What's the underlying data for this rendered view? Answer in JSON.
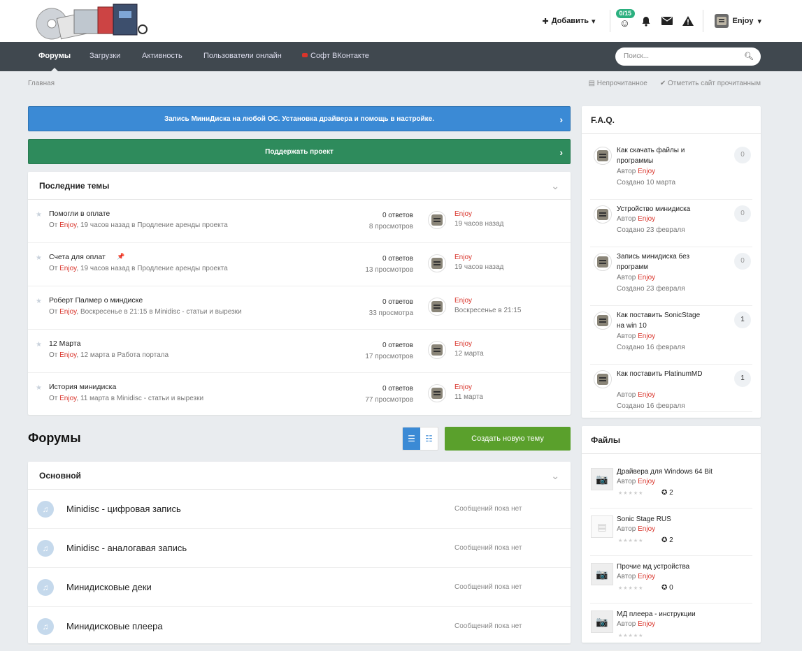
{
  "header": {
    "add_label": "Добавить",
    "badge": "0/15",
    "user": "Enjoy"
  },
  "nav": {
    "items": [
      "Форумы",
      "Загрузки",
      "Активность",
      "Пользователи онлайн",
      "Софт ВКонтакте"
    ],
    "search_placeholder": "Поиск..."
  },
  "breadcrumb": "Главная",
  "mark_links": [
    "Непрочитанное",
    "Отметить сайт прочитанным"
  ],
  "banners": [
    "Запись МиниДиска на любой ОС. Установка драйвера и помощь в настройке.",
    "Поддержать проект"
  ],
  "recent": {
    "title": "Последние темы",
    "topics": [
      {
        "title": "Помогли в оплате",
        "prefix": "От",
        "author": "Enjoy",
        "meta": ", 19 часов назад в Продление аренды проекта",
        "answers": "0 ответов",
        "views": "8 просмотров",
        "last_user": "Enjoy",
        "last_time": "19 часов назад",
        "pinned": false
      },
      {
        "title": "Счета для оплат",
        "prefix": "От",
        "author": "Enjoy",
        "meta": ", 19 часов назад в Продление аренды проекта",
        "answers": "0 ответов",
        "views": "13 просмотров",
        "last_user": "Enjoy",
        "last_time": "19 часов назад",
        "pinned": true
      },
      {
        "title": "Роберт Палмер о миндиске",
        "prefix": "От",
        "author": "Enjoy",
        "meta": ", Воскресенье в 21:15 в Minidisc - статьи и вырезки",
        "answers": "0 ответов",
        "views": "33 просмотра",
        "last_user": "Enjoy",
        "last_time": "Воскресенье в 21:15",
        "pinned": false
      },
      {
        "title": "12 Марта",
        "prefix": "От",
        "author": "Enjoy",
        "meta": ", 12 марта в Работа портала",
        "answers": "0 ответов",
        "views": "17 просмотров",
        "last_user": "Enjoy",
        "last_time": "12 марта",
        "pinned": false
      },
      {
        "title": "История минидиска",
        "prefix": "От",
        "author": "Enjoy",
        "meta": ", 11 марта в Minidisc - статьи и вырезки",
        "answers": "0 ответов",
        "views": "77 просмотров",
        "last_user": "Enjoy",
        "last_time": "11 марта",
        "pinned": false
      }
    ]
  },
  "forums": {
    "heading": "Форумы",
    "new_topic": "Создать новую тему",
    "category": "Основной",
    "rows": [
      {
        "name": "Minidisc - цифровая запись",
        "last": "Сообщений пока нет"
      },
      {
        "name": "Minidisc - аналогавая запись",
        "last": "Сообщений пока нет"
      },
      {
        "name": "Минидисковые деки",
        "last": "Сообщений пока нет"
      },
      {
        "name": "Минидисковые плеера",
        "last": "Сообщений пока нет"
      }
    ]
  },
  "faq": {
    "title": "F.A.Q.",
    "items": [
      {
        "title": "Как скачать файлы и программы",
        "by": "Автор",
        "author": "Enjoy",
        "created": "Создано 10 марта",
        "count": "0"
      },
      {
        "title": "Устройство минидиска",
        "by": "Автор",
        "author": "Enjoy",
        "created": "Создано 23 февраля",
        "count": "0"
      },
      {
        "title": "Запись минидиска без программ",
        "by": "Автор",
        "author": "Enjoy",
        "created": "Создано 23 февраля",
        "count": "0"
      },
      {
        "title": "Как поставить SonicStage на win 10",
        "by": "Автор",
        "author": "Enjoy",
        "created": "Создано 16 февраля",
        "count": "1"
      },
      {
        "title": "Как поставить PlatinumMD",
        "by": "Автор",
        "author": "Enjoy",
        "created": "Создано 16 февраля",
        "count": "1"
      }
    ]
  },
  "files": {
    "title": "Файлы",
    "items": [
      {
        "title": "Драйвера для Windows 64 Bit",
        "by": "Автор",
        "author": "Enjoy",
        "downloads": "2",
        "thumb": "camera-icon"
      },
      {
        "title": "Sonic Stage RUS",
        "by": "Автор",
        "author": "Enjoy",
        "downloads": "2",
        "thumb": "document-icon"
      },
      {
        "title": "Прочие мд устройства",
        "by": "Автор",
        "author": "Enjoy",
        "downloads": "0",
        "thumb": "camera-icon"
      },
      {
        "title": "МД плеера - инструкции",
        "by": "Автор",
        "author": "Enjoy",
        "downloads": "",
        "thumb": "camera-icon"
      }
    ]
  }
}
